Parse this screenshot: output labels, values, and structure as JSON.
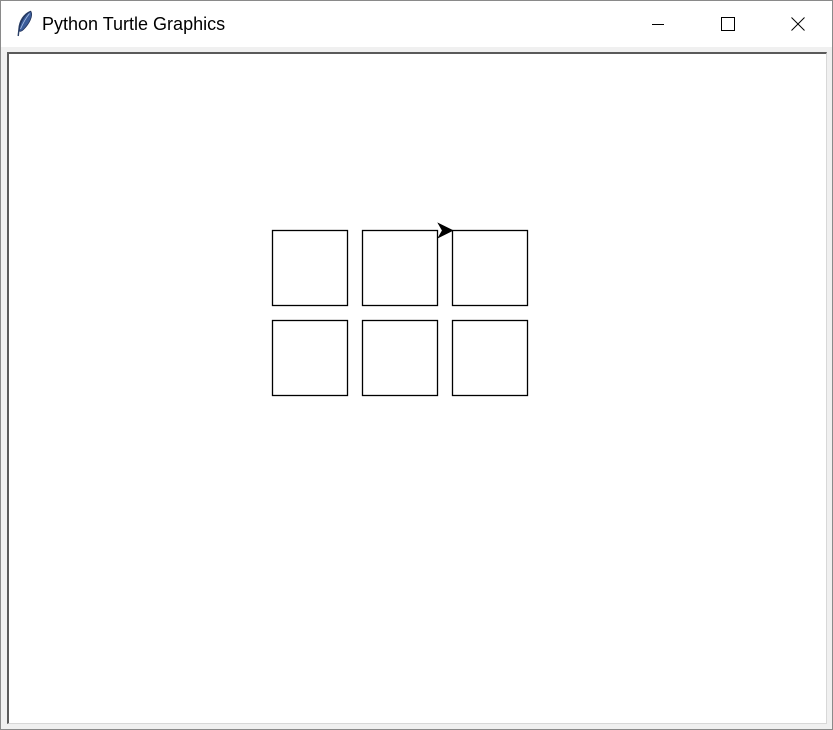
{
  "window": {
    "title": "Python Turtle Graphics",
    "app_icon": "feather-icon",
    "controls": {
      "minimize": "minimize-icon",
      "maximize": "maximize-icon",
      "close": "close-icon"
    }
  },
  "canvas": {
    "background": "#ffffff",
    "stroke_color": "#000000",
    "shapes": [
      {
        "type": "square",
        "row": 1,
        "col": 1
      },
      {
        "type": "square",
        "row": 1,
        "col": 2
      },
      {
        "type": "square",
        "row": 1,
        "col": 3
      },
      {
        "type": "square",
        "row": 2,
        "col": 1
      },
      {
        "type": "square",
        "row": 2,
        "col": 2
      },
      {
        "type": "square",
        "row": 2,
        "col": 3
      }
    ],
    "turtle": {
      "shape": "arrow",
      "heading": "east",
      "color": "#000000"
    }
  }
}
